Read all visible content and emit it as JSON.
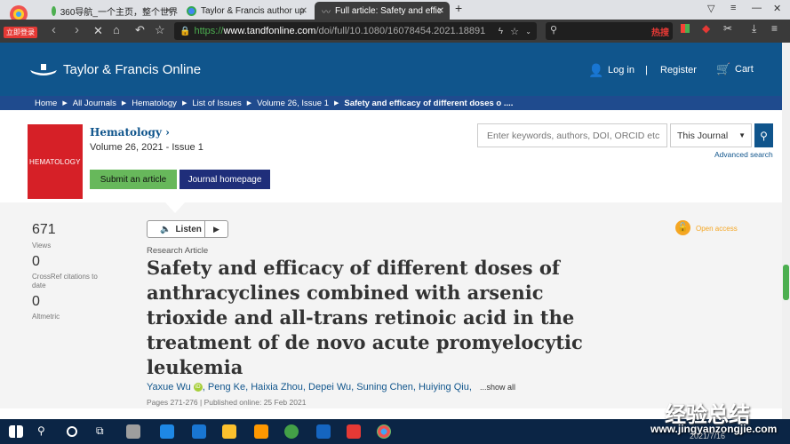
{
  "browser": {
    "badge": "立即登录",
    "tabs": [
      {
        "title": "360导航_一个主页，整个世界"
      },
      {
        "title": "Taylor & Francis author up"
      },
      {
        "title": "Full article: Safety and effic"
      }
    ],
    "url": {
      "scheme": "https://",
      "host": "www.tandfonline.com",
      "path": "/doi/full/10.1080/16078454.2021.18891"
    },
    "search_hot": "热搜"
  },
  "site": {
    "brand": "Taylor & Francis Online",
    "login": "Log in",
    "register": "Register",
    "cart": "Cart"
  },
  "breadcrumb": [
    "Home",
    "All Journals",
    "Hematology",
    "List of Issues",
    "Volume 26, Issue 1",
    "Safety and efficacy of different doses o ...."
  ],
  "journal": {
    "cover_text": "HEMATOLOGY",
    "title": "Hematology ›",
    "volume": "Volume 26, 2021 - Issue 1",
    "submit": "Submit an article",
    "homepage": "Journal homepage"
  },
  "search": {
    "placeholder": "Enter keywords, authors, DOI, ORCID etc",
    "scope": "This Journal",
    "advanced": "Advanced search"
  },
  "metrics": [
    {
      "value": "671",
      "label": "Views"
    },
    {
      "value": "0",
      "label": "CrossRef citations to date"
    },
    {
      "value": "0",
      "label": "Altmetric"
    }
  ],
  "article": {
    "listen": "Listen",
    "open_access": "Open access",
    "type": "Research Article",
    "title": "Safety and efficacy of different doses of anthracyclines combined with arsenic trioxide and all-trans retinoic acid in the treatment of de novo acute promyelocytic leukemia",
    "authors": "Yaxue Wu",
    "authors_rest": ", Peng Ke, Haixia Zhou, Depei Wu, Suning Chen, Huiying Qiu,",
    "show_all": "...show all",
    "pages": "Pages 271-276 | Published online: 25 Feb 2021"
  },
  "overlay": {
    "watermark": "经验总结",
    "watermark_url": "www.jingyanzongjie.com",
    "clock": "2021/7/16"
  },
  "colors": {
    "brand_blue": "#10558c",
    "breadcrumb_blue": "#1f4b8e",
    "submit_green": "#67b85b",
    "homepage_navy": "#1f2e7a",
    "cover_red": "#d62027",
    "oa_orange": "#f5a623"
  }
}
